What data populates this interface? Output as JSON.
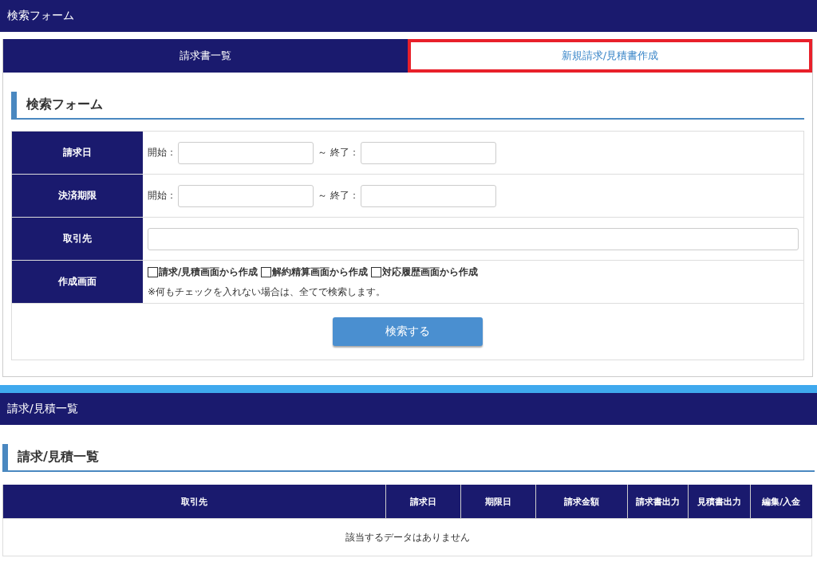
{
  "top_bar": {
    "title": "検索フォーム"
  },
  "tabs": [
    {
      "label": "請求書一覧",
      "selected": true,
      "highlighted": false
    },
    {
      "label": "新規請求/見積書作成",
      "selected": false,
      "highlighted": true
    }
  ],
  "search_form": {
    "heading": "検索フォーム",
    "rows": [
      {
        "kind": "range",
        "label": "請求日",
        "start_label": "開始：",
        "end_label": "～ 終了："
      },
      {
        "kind": "range",
        "label": "決済期限",
        "start_label": "開始：",
        "end_label": "～ 終了："
      },
      {
        "kind": "text",
        "label": "取引先"
      },
      {
        "kind": "checks",
        "label": "作成画面",
        "options": [
          {
            "label": "請求/見積画面から作成",
            "checked": false
          },
          {
            "label": "解約精算画面から作成",
            "checked": false
          },
          {
            "label": "対応履歴画面から作成",
            "checked": false
          }
        ],
        "note": "※何もチェックを入れない場合は、全てで検索します。"
      }
    ],
    "submit": "検索する"
  },
  "list_bar": {
    "title": "請求/見積一覧"
  },
  "list": {
    "heading": "請求/見積一覧",
    "columns": [
      "取引先",
      "請求日",
      "期限日",
      "請求金額",
      "請求書出力",
      "見積書出力",
      "編集/入金"
    ],
    "empty": "該当するデータはありません"
  }
}
